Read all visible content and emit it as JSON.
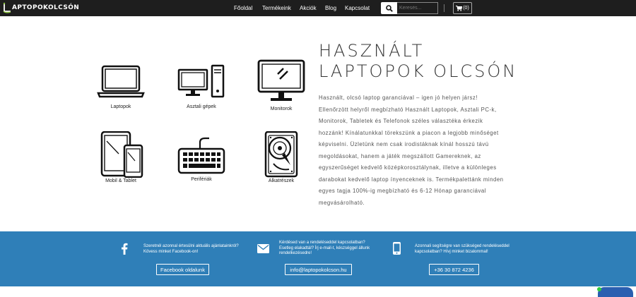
{
  "header": {
    "logo_text": "APTOPOKOLCSÓN",
    "nav": [
      "Főoldal",
      "Termékeink",
      "Akciók",
      "Blog",
      "Kapcsolat"
    ],
    "search_placeholder": "Keresés...",
    "cart_count": "(0)"
  },
  "hero": {
    "title_line1": "HASZNÁLT",
    "title_line2": "LAPTOPOK OLCSÓN",
    "description": "Használt, olcsó laptop garanciával – igen jó helyen jársz! Ellenőrzött helyről megbízható Használt Laptopok, Asztali PC-k, Monitorok, Tabletek és Telefonok széles választéka érkezik hozzánk! Kínálatunkkal törekszünk a piacon a legjobb minőséget képviselni. Üzletünk nem csak irodistáknak kínál hosszú távú megoldásokat, hanem a játék megszállott Gamereknek, az egyszerűséget kedvelő középkorosztálynak, illetve a különleges darabokat kedvelő laptop ínyenceknek is. Termékpalettánk minden egyes tagja 100%-ig megbízható és 6-12 Hónap garanciával megvásárolható.",
    "categories": [
      {
        "label": "Laptopok",
        "icon": "laptop-icon"
      },
      {
        "label": "Asztali gépek",
        "icon": "desktop-pc-icon"
      },
      {
        "label": "Monitorok",
        "icon": "monitor-icon"
      },
      {
        "label": "Mobil & Tablet",
        "icon": "tablet-phone-icon"
      },
      {
        "label": "Perifériák",
        "icon": "keyboard-icon"
      },
      {
        "label": "Alkatrészek",
        "icon": "hard-drive-icon"
      }
    ]
  },
  "contact_band": {
    "facebook": {
      "text_line1": "Szeretnél azonnal értesülni aktuális ajánlatainkról?",
      "text_line2": "Kövess minket Facebook-on!",
      "button": "Facebook oldalunk",
      "icon": "facebook-icon"
    },
    "email": {
      "text_line1": "Kérdésed van a rendeléseddel kapcsolatban?",
      "text_line2": "Esetleg elakadtál? Írj e-mail-t, készséggel állunk",
      "text_line3": "rendelkezésedre!",
      "button": "info@laptopokolcson.hu",
      "icon": "envelope-icon"
    },
    "phone": {
      "text_line1": "Azonnali segítségre van szükséged rendeléseddel",
      "text_line2": "kapcsolatban? Hívj minket bizalommal!",
      "button": "+36 30 872 4236",
      "icon": "mobile-phone-icon"
    }
  },
  "colors": {
    "nav_bg": "#1e1e1e",
    "band_bg": "#2f7fb8",
    "logo_accent": "#8dc63f"
  }
}
